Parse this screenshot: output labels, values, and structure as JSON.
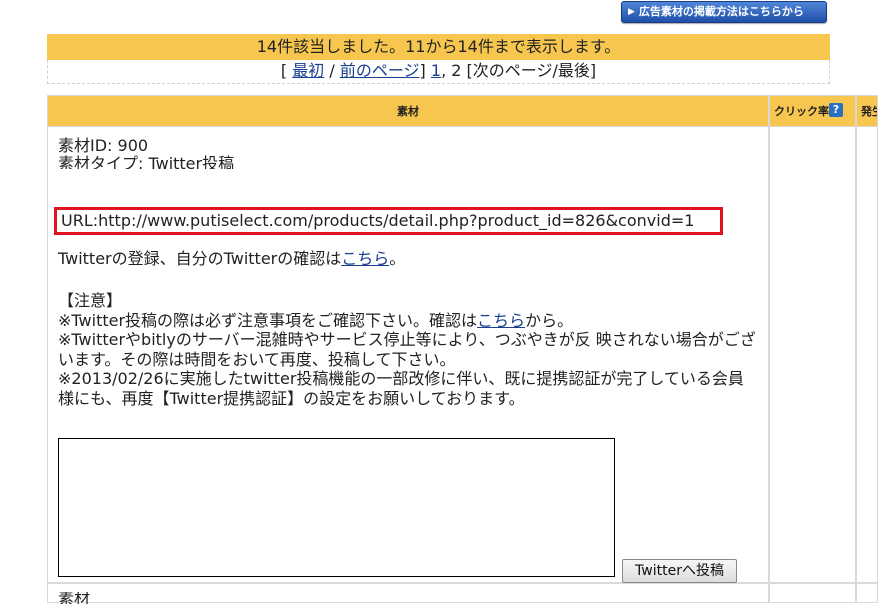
{
  "top_button": {
    "label": "広告素材の掲載方法はこちらから",
    "icon": "play-triangle-icon"
  },
  "results": {
    "summary": "14件該当しました。11から14件まで表示します。",
    "pager": {
      "open_bracket": "[",
      "first": "最初",
      "sep": "/",
      "prev": "前のページ",
      "close_bracket": "]",
      "page1": "1",
      "page2": "2",
      "next_last": "[次のページ/最後]"
    }
  },
  "table": {
    "headers": {
      "sozai": "素材",
      "click_rate": "クリック率",
      "hassei": "発生"
    },
    "help_icon": "?",
    "row": {
      "material_id": "素材ID: 900",
      "material_type": "素材タイプ: Twitter投稿",
      "url": "URL:http://www.putiselect.com/products/detail.php?product_id=826&convid=1",
      "register_text": "Twitterの登録、自分のTwitterの確認は",
      "register_link": "こちら",
      "register_end": "。",
      "caution_title": "【注意】",
      "caution1_pre": "※Twitter投稿の際は必ず注意事項をご確認下さい。確認は",
      "caution1_link": "こちら",
      "caution1_post": "から。",
      "caution2": "※Twitterやbitlyのサーバー混雑時やサービス停止等により、つぶやきが反 映されない場合がございます。その際は時間をおいて再度、投稿して下さい。",
      "caution3": "※2013/02/26に実施したtwitter投稿機能の一部改修に伴い、既に提携認証が完了している会員様にも、再度【Twitter提携認証】の設定をお願いしております。",
      "tweet_text": "",
      "tweet_button": "Twitterへ投稿"
    },
    "next_row_label": "素材"
  },
  "colors": {
    "header_bg": "#f6c64e",
    "link": "#1a3f8f",
    "highlight_border": "#e0141e",
    "top_button_bg": "#2a5fb8"
  }
}
